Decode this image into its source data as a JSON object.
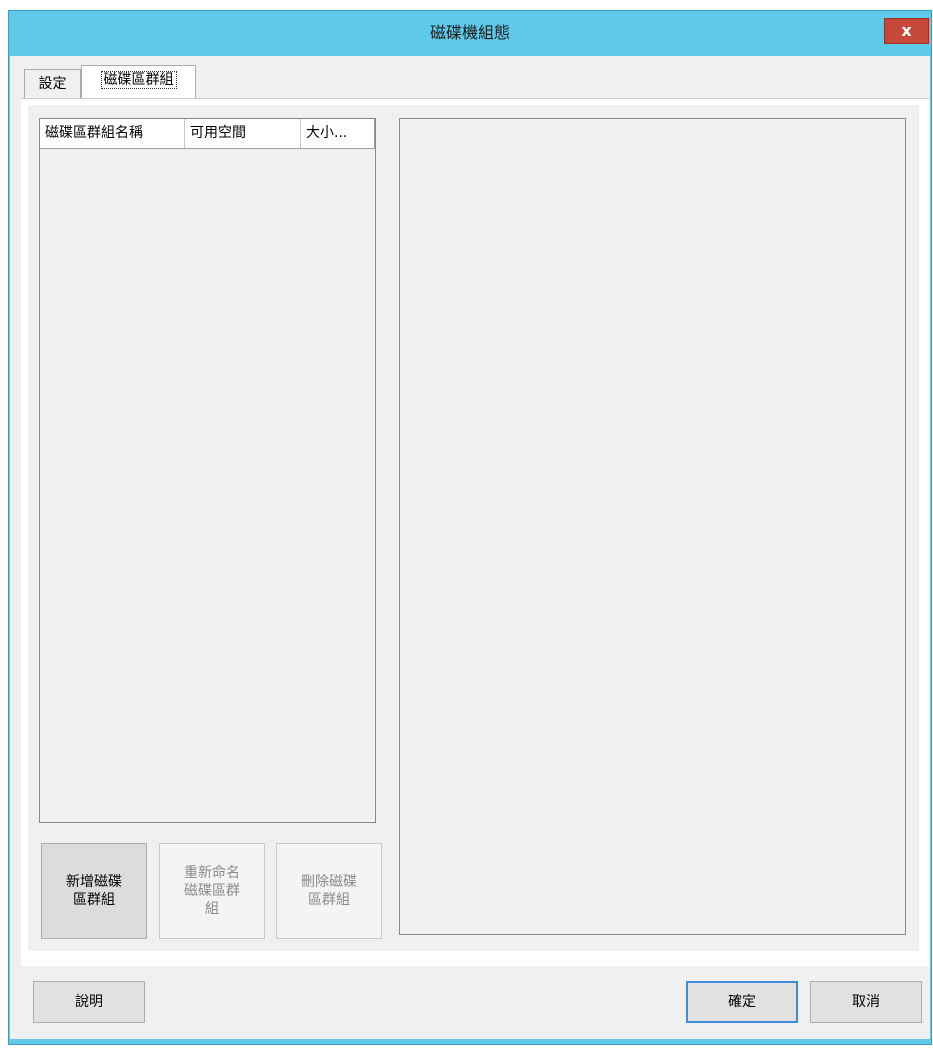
{
  "window": {
    "title": "磁碟機組態",
    "close_label": "x"
  },
  "tabs": [
    {
      "label": "設定"
    },
    {
      "label": "磁碟區群組"
    }
  ],
  "list": {
    "columns": [
      "磁碟區群組名稱",
      "可用空間",
      "大小..."
    ],
    "rows": []
  },
  "group_buttons": {
    "add": "新增磁碟\n區群組",
    "rename": "重新命名\n磁碟區群\n組",
    "delete": "刪除磁碟\n區群組"
  },
  "dialog_buttons": {
    "help": "說明",
    "ok": "確定",
    "cancel": "取消"
  },
  "colors": {
    "titlebar": "#5fc9e9",
    "close": "#c6483a",
    "accent": "#3c8edb"
  }
}
